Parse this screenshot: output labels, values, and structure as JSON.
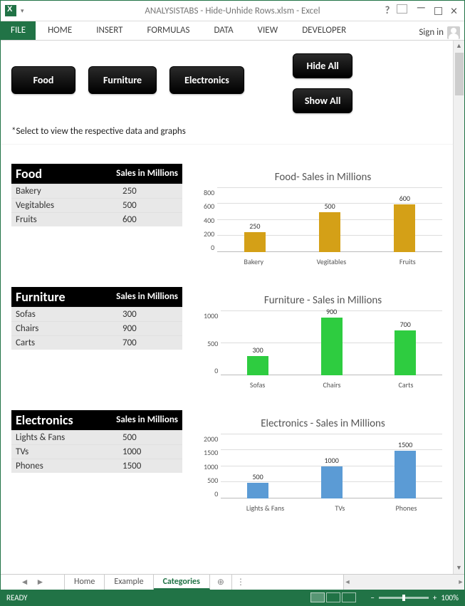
{
  "window": {
    "title": "ANALYSISTABS - Hide-Unhide Rows.xlsm - Excel"
  },
  "menu": {
    "file": "FILE",
    "tabs": [
      "HOME",
      "INSERT",
      "FORMULAS",
      "DATA",
      "VIEW",
      "DEVELOPER"
    ],
    "signin": "Sign in"
  },
  "buttons": {
    "food": "Food",
    "furniture": "Furniture",
    "electronics": "Electronics",
    "hideall": "Hide All",
    "showall": "Show All"
  },
  "hint": "*Select to view the respective data and graphs",
  "col_header": "Sales in Millions",
  "sections": {
    "food": {
      "name": "Food",
      "chart_title": "Food- Sales in Millions",
      "rows": [
        {
          "label": "Bakery",
          "value": "250"
        },
        {
          "label": "Vegitables",
          "value": "500"
        },
        {
          "label": "Fruits",
          "value": "600"
        }
      ],
      "yticks": [
        "800",
        "600",
        "400",
        "200",
        "0"
      ]
    },
    "furniture": {
      "name": "Furniture",
      "chart_title": "Furniture - Sales in Millions",
      "rows": [
        {
          "label": "Sofas",
          "value": "300"
        },
        {
          "label": "Chairs",
          "value": "900"
        },
        {
          "label": "Carts",
          "value": "700"
        }
      ],
      "yticks": [
        "1000",
        "500",
        "0"
      ]
    },
    "electronics": {
      "name": "Electronics",
      "chart_title": "Electronics - Sales in Millions",
      "rows": [
        {
          "label": "Lights & Fans",
          "value": "500"
        },
        {
          "label": "TVs",
          "value": "1000"
        },
        {
          "label": "Phones",
          "value": "1500"
        }
      ],
      "yticks": [
        "2000",
        "1500",
        "1000",
        "500",
        "0"
      ]
    }
  },
  "sheets": {
    "tabs": [
      "Home",
      "Example",
      "Categories"
    ],
    "active": "Categories"
  },
  "status": {
    "ready": "READY",
    "zoom": "100%"
  },
  "chart_data": [
    {
      "type": "bar",
      "title": "Food- Sales in Millions",
      "categories": [
        "Bakery",
        "Vegitables",
        "Fruits"
      ],
      "values": [
        250,
        500,
        600
      ],
      "ylim": [
        0,
        800
      ],
      "color": "#d4a017"
    },
    {
      "type": "bar",
      "title": "Furniture - Sales in Millions",
      "categories": [
        "Sofas",
        "Chairs",
        "Carts"
      ],
      "values": [
        300,
        900,
        700
      ],
      "ylim": [
        0,
        1000
      ],
      "color": "#2ecc40"
    },
    {
      "type": "bar",
      "title": "Electronics - Sales in Millions",
      "categories": [
        "Lights & Fans",
        "TVs",
        "Phones"
      ],
      "values": [
        500,
        1000,
        1500
      ],
      "ylim": [
        0,
        2000
      ],
      "color": "#5b9bd5"
    }
  ]
}
